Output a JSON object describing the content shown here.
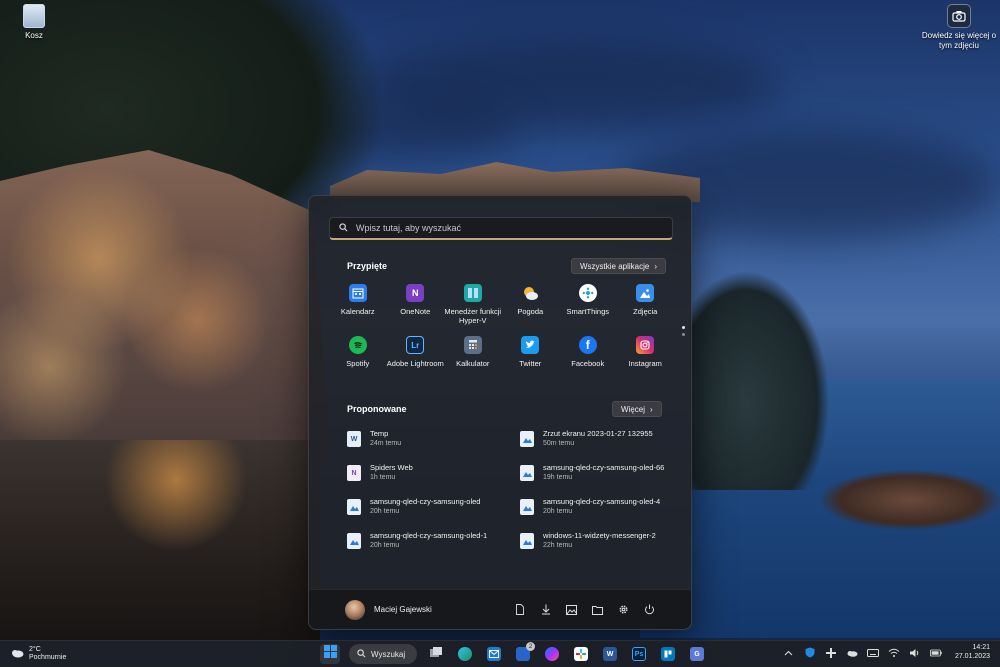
{
  "desktop": {
    "recycle_bin_label": "Kosz",
    "spotlight_label": "Dowiedz się więcej o tym zdjęciu"
  },
  "start_menu": {
    "search_placeholder": "Wpisz tutaj, aby wyszukać",
    "pinned_title": "Przypięte",
    "all_apps_label": "Wszystkie aplikacje",
    "pinned": [
      {
        "label": "Kalendarz",
        "icon": "calendar-icon",
        "color": "#2b7de9"
      },
      {
        "label": "OneNote",
        "icon": "onenote-icon",
        "color": "#7b3fc4"
      },
      {
        "label": "Menedżer funkcji Hyper-V",
        "icon": "hyperv-icon",
        "color": "#1fa9a4"
      },
      {
        "label": "Pogoda",
        "icon": "weather-icon",
        "color": "#f4a52a"
      },
      {
        "label": "SmartThings",
        "icon": "smartthings-icon",
        "color": "#ffffff"
      },
      {
        "label": "Zdjęcia",
        "icon": "photos-icon",
        "color": "#3a8ee6"
      },
      {
        "label": "Spotify",
        "icon": "spotify-icon",
        "color": "#1db954"
      },
      {
        "label": "Adobe Lightroom",
        "icon": "lightroom-icon",
        "color": "#0c2a45"
      },
      {
        "label": "Kalkulator",
        "icon": "calculator-icon",
        "color": "#5b6f86"
      },
      {
        "label": "Twitter",
        "icon": "twitter-icon",
        "color": "#1d9bf0"
      },
      {
        "label": "Facebook",
        "icon": "facebook-icon",
        "color": "#1877f2"
      },
      {
        "label": "Instagram",
        "icon": "instagram-icon",
        "color": "#d6306f"
      }
    ],
    "recommended_title": "Proponowane",
    "more_label": "Więcej",
    "recommended": [
      {
        "name": "Temp",
        "time": "24m temu",
        "icon": "word-doc-icon"
      },
      {
        "name": "Zrzut ekranu 2023-01-27 132955",
        "time": "50m temu",
        "icon": "image-file-icon"
      },
      {
        "name": "Spiders Web",
        "time": "1h temu",
        "icon": "onenote-file-icon"
      },
      {
        "name": "samsung-qled-czy-samsung-oled-66",
        "time": "19h temu",
        "icon": "image-file-icon"
      },
      {
        "name": "samsung-qled-czy-samsung-oled",
        "time": "20h temu",
        "icon": "image-file-icon"
      },
      {
        "name": "samsung-qled-czy-samsung-oled-4",
        "time": "20h temu",
        "icon": "image-file-icon"
      },
      {
        "name": "samsung-qled-czy-samsung-oled-1",
        "time": "20h temu",
        "icon": "image-file-icon"
      },
      {
        "name": "windows-11-widzety-messenger-2",
        "time": "22h temu",
        "icon": "image-file-icon"
      }
    ],
    "user_name": "Maciej Gajewski"
  },
  "taskbar": {
    "temperature": "2°C",
    "condition": "Pochmurnie",
    "search_label": "Wyszukaj",
    "mail_badge": "2",
    "time": "14:21",
    "date": "27.01.2023"
  },
  "colors": {
    "search_underline": "#c6a77a",
    "menu_bg": "#202228"
  }
}
